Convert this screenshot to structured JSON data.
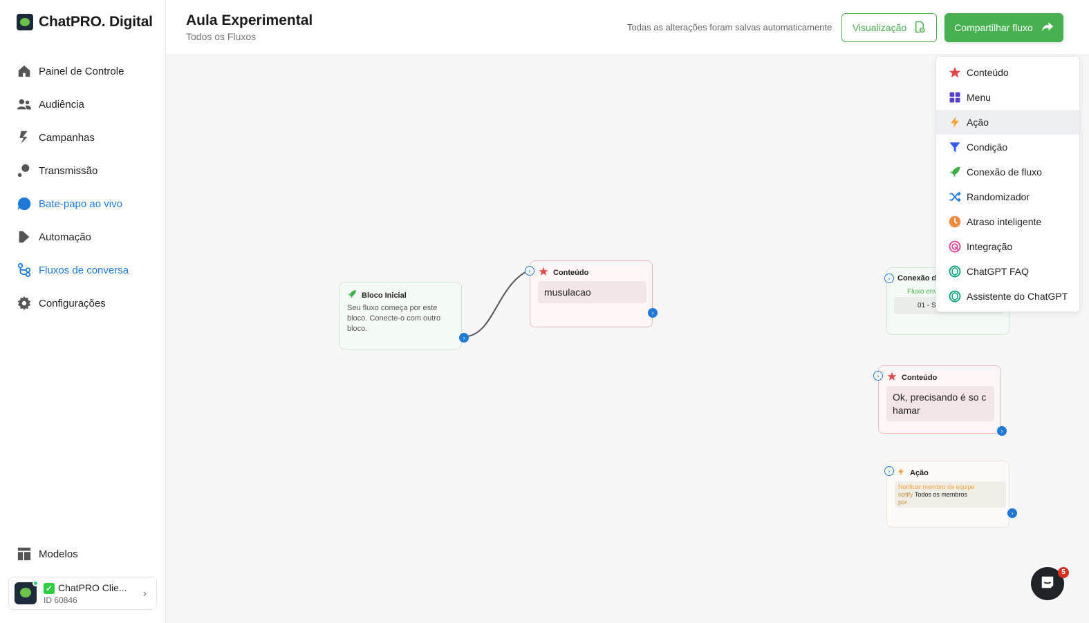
{
  "brand": {
    "name": "ChatPRO. Digital"
  },
  "sidebar": {
    "items": [
      {
        "label": "Painel de Controle",
        "icon": "home-icon"
      },
      {
        "label": "Audiência",
        "icon": "users-icon"
      },
      {
        "label": "Campanhas",
        "icon": "campaign-icon"
      },
      {
        "label": "Transmissão",
        "icon": "broadcast-icon"
      },
      {
        "label": "Bate-papo ao vivo",
        "icon": "chat-icon"
      },
      {
        "label": "Automação",
        "icon": "automation-icon"
      },
      {
        "label": "Fluxos de conversa",
        "icon": "flows-icon"
      },
      {
        "label": "Configurações",
        "icon": "gear-icon"
      }
    ],
    "models_label": "Modelos",
    "account": {
      "name": "ChatPRO Clie...",
      "id": "ID 60846"
    }
  },
  "header": {
    "title": "Aula Experimental",
    "subtitle": "Todos os Fluxos",
    "saved_status": "Todas as alterações foram salvas automaticamente",
    "preview_label": "Visualização",
    "share_label": "Compartilhar fluxo"
  },
  "canvas": {
    "start_node": {
      "title": "Bloco Inicial",
      "description": "Seu fluxo começa por este bloco. Conecte-o com outro bloco."
    },
    "content_node_1": {
      "title": "Conteúdo",
      "message": "musulacao"
    },
    "connection_node": {
      "title": "Conexão de",
      "label": "Fluxo env",
      "value": "01 - SI"
    },
    "content_node_2": {
      "title": "Conteúdo",
      "message": "Ok, precisando é so c hamar"
    },
    "action_node": {
      "title": "Ação",
      "line1": "Notificar membro da equipe",
      "notify_label": "notify",
      "notify_value": "Todos os membros",
      "line3": "por"
    }
  },
  "menu": {
    "items": [
      {
        "label": "Conteúdo",
        "icon": "star-icon",
        "color": "#e54848"
      },
      {
        "label": "Menu",
        "icon": "grid-icon",
        "color": "#5b3fc4"
      },
      {
        "label": "Ação",
        "icon": "lightning-icon",
        "color": "#f2a33a"
      },
      {
        "label": "Condição",
        "icon": "funnel-icon",
        "color": "#2f5ee8"
      },
      {
        "label": "Conexão de fluxo",
        "icon": "rocket-icon",
        "color": "#3fae49"
      },
      {
        "label": "Randomizador",
        "icon": "shuffle-icon",
        "color": "#1e7ad6"
      },
      {
        "label": "Atraso inteligente",
        "icon": "clock-icon",
        "color": "#f08a3c"
      },
      {
        "label": "Integração",
        "icon": "integration-icon",
        "color": "#e0489b"
      },
      {
        "label": "ChatGPT FAQ",
        "icon": "chatgpt-icon",
        "color": "#10a37f"
      },
      {
        "label": "Assistente do ChatGPT",
        "icon": "chatgpt-icon",
        "color": "#10a37f"
      }
    ]
  },
  "chat": {
    "badge": "5"
  },
  "colors": {
    "accent": "#1e7ad6",
    "green": "#47b151"
  }
}
